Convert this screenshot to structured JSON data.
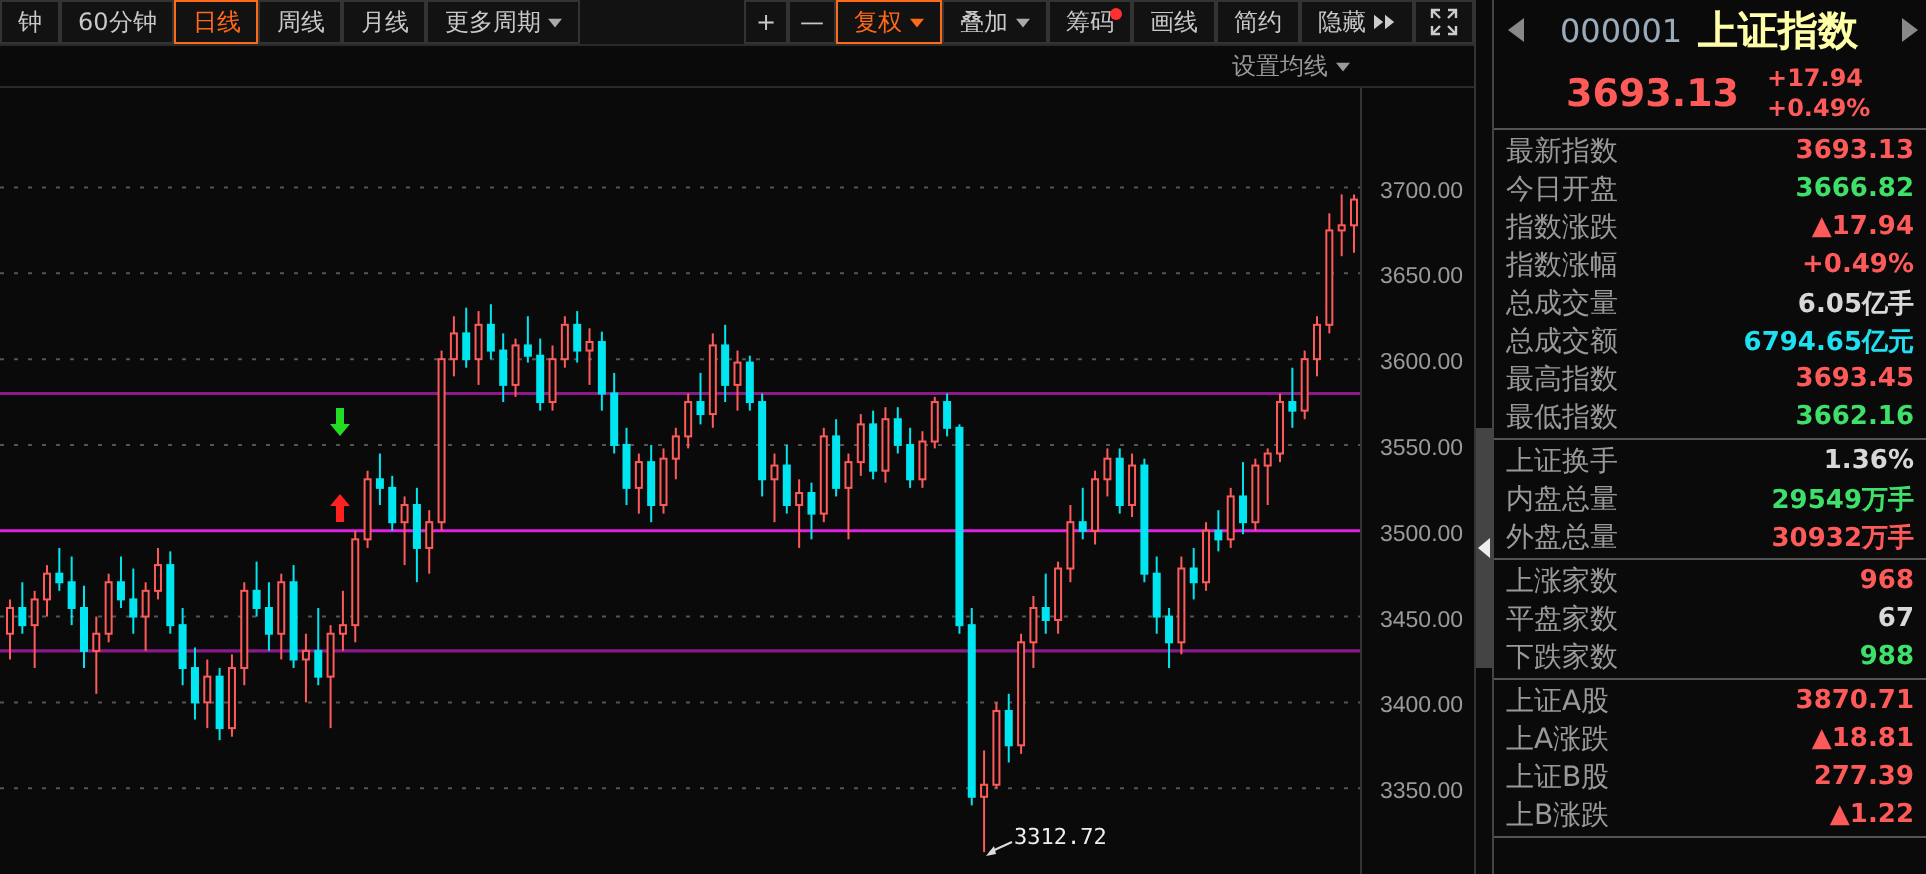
{
  "toolbar": {
    "periods": [
      {
        "label": "钟",
        "selected": false,
        "dropdown": false
      },
      {
        "label": "60分钟",
        "selected": false,
        "dropdown": false
      },
      {
        "label": "日线",
        "selected": true,
        "dropdown": false
      },
      {
        "label": "周线",
        "selected": false,
        "dropdown": false
      },
      {
        "label": "月线",
        "selected": false,
        "dropdown": false
      },
      {
        "label": "更多周期",
        "selected": false,
        "dropdown": true
      }
    ],
    "tools": [
      {
        "kind": "text",
        "label": "+",
        "active": false
      },
      {
        "kind": "text",
        "label": "—",
        "active": false
      },
      {
        "kind": "dropdown",
        "label": "复权",
        "active": true
      },
      {
        "kind": "dropdown",
        "label": "叠加",
        "active": false
      },
      {
        "kind": "dot",
        "label": "筹码",
        "active": false
      },
      {
        "kind": "text",
        "label": "画线",
        "active": false
      },
      {
        "kind": "text",
        "label": "简约",
        "active": false
      },
      {
        "kind": "expand",
        "label": "隐藏",
        "active": false
      },
      {
        "kind": "fullscreen",
        "active": false
      }
    ]
  },
  "ma_settings": {
    "label": "设置均线"
  },
  "chart": {
    "chart_data": {
      "type": "candlestick",
      "ylim": [
        3300,
        3758
      ],
      "grid": true,
      "ref_lines": [
        {
          "axis": "y",
          "value": 3580,
          "color": "#8a1a8a"
        },
        {
          "axis": "y",
          "value": 3500,
          "color": "#e020e0"
        },
        {
          "axis": "y",
          "value": 3430,
          "color": "#8a1a8a"
        }
      ],
      "yticks": [
        {
          "value": 3700,
          "label": "3700.00"
        },
        {
          "value": 3650,
          "label": "3650.00"
        },
        {
          "value": 3600,
          "label": "3600.00"
        },
        {
          "value": 3550,
          "label": "3550.00"
        },
        {
          "value": 3500,
          "label": "3500.00"
        },
        {
          "value": 3450,
          "label": "3450.00"
        },
        {
          "value": 3400,
          "label": "3400.00"
        },
        {
          "value": 3350,
          "label": "3350.00"
        }
      ],
      "ohlc": [
        [
          3440,
          3460,
          3425,
          3455
        ],
        [
          3455,
          3470,
          3440,
          3445
        ],
        [
          3445,
          3465,
          3420,
          3460
        ],
        [
          3460,
          3480,
          3450,
          3475
        ],
        [
          3475,
          3490,
          3465,
          3470
        ],
        [
          3470,
          3485,
          3445,
          3455
        ],
        [
          3455,
          3468,
          3420,
          3430
        ],
        [
          3430,
          3450,
          3405,
          3440
        ],
        [
          3440,
          3475,
          3435,
          3470
        ],
        [
          3470,
          3485,
          3455,
          3460
        ],
        [
          3460,
          3478,
          3440,
          3450
        ],
        [
          3450,
          3470,
          3430,
          3465
        ],
        [
          3465,
          3490,
          3460,
          3480
        ],
        [
          3480,
          3488,
          3440,
          3445
        ],
        [
          3445,
          3455,
          3410,
          3420
        ],
        [
          3420,
          3432,
          3390,
          3400
        ],
        [
          3400,
          3425,
          3385,
          3415
        ],
        [
          3415,
          3420,
          3378,
          3385
        ],
        [
          3385,
          3428,
          3380,
          3420
        ],
        [
          3420,
          3470,
          3410,
          3465
        ],
        [
          3465,
          3482,
          3450,
          3455
        ],
        [
          3455,
          3470,
          3430,
          3440
        ],
        [
          3440,
          3475,
          3425,
          3470
        ],
        [
          3470,
          3480,
          3420,
          3425
        ],
        [
          3425,
          3440,
          3400,
          3430
        ],
        [
          3430,
          3455,
          3410,
          3415
        ],
        [
          3415,
          3445,
          3385,
          3440
        ],
        [
          3440,
          3465,
          3430,
          3445
        ],
        [
          3445,
          3500,
          3435,
          3495
        ],
        [
          3495,
          3535,
          3490,
          3530
        ],
        [
          3530,
          3545,
          3515,
          3525
        ],
        [
          3525,
          3532,
          3500,
          3505
        ],
        [
          3505,
          3520,
          3480,
          3515
        ],
        [
          3515,
          3525,
          3470,
          3490
        ],
        [
          3490,
          3512,
          3475,
          3505
        ],
        [
          3505,
          3605,
          3500,
          3600
        ],
        [
          3600,
          3625,
          3590,
          3615
        ],
        [
          3615,
          3630,
          3595,
          3600
        ],
        [
          3600,
          3628,
          3585,
          3620
        ],
        [
          3620,
          3632,
          3600,
          3605
        ],
        [
          3605,
          3615,
          3575,
          3585
        ],
        [
          3585,
          3612,
          3578,
          3608
        ],
        [
          3608,
          3625,
          3598,
          3602
        ],
        [
          3602,
          3612,
          3570,
          3575
        ],
        [
          3575,
          3608,
          3570,
          3600
        ],
        [
          3600,
          3625,
          3595,
          3620
        ],
        [
          3620,
          3628,
          3598,
          3605
        ],
        [
          3605,
          3618,
          3585,
          3610
        ],
        [
          3610,
          3616,
          3570,
          3580
        ],
        [
          3580,
          3592,
          3545,
          3550
        ],
        [
          3550,
          3560,
          3515,
          3525
        ],
        [
          3525,
          3545,
          3510,
          3540
        ],
        [
          3540,
          3550,
          3505,
          3515
        ],
        [
          3515,
          3548,
          3510,
          3542
        ],
        [
          3542,
          3560,
          3530,
          3555
        ],
        [
          3555,
          3580,
          3548,
          3575
        ],
        [
          3575,
          3592,
          3562,
          3568
        ],
        [
          3568,
          3615,
          3560,
          3608
        ],
        [
          3608,
          3620,
          3575,
          3585
        ],
        [
          3585,
          3605,
          3570,
          3598
        ],
        [
          3598,
          3602,
          3570,
          3575
        ],
        [
          3575,
          3580,
          3520,
          3530
        ],
        [
          3530,
          3545,
          3505,
          3538
        ],
        [
          3538,
          3550,
          3510,
          3515
        ],
        [
          3515,
          3530,
          3490,
          3522
        ],
        [
          3522,
          3528,
          3495,
          3510
        ],
        [
          3510,
          3560,
          3505,
          3555
        ],
        [
          3555,
          3565,
          3520,
          3525
        ],
        [
          3525,
          3545,
          3495,
          3540
        ],
        [
          3540,
          3568,
          3532,
          3562
        ],
        [
          3562,
          3570,
          3530,
          3535
        ],
        [
          3535,
          3572,
          3528,
          3565
        ],
        [
          3565,
          3572,
          3545,
          3550
        ],
        [
          3550,
          3560,
          3525,
          3530
        ],
        [
          3530,
          3558,
          3525,
          3552
        ],
        [
          3552,
          3578,
          3548,
          3575
        ],
        [
          3575,
          3580,
          3555,
          3560
        ],
        [
          3560,
          3562,
          3440,
          3445
        ],
        [
          3445,
          3455,
          3340,
          3345
        ],
        [
          3345,
          3372,
          3312.72,
          3352
        ],
        [
          3352,
          3400,
          3350,
          3395
        ],
        [
          3395,
          3405,
          3365,
          3375
        ],
        [
          3375,
          3440,
          3370,
          3435
        ],
        [
          3435,
          3462,
          3420,
          3455
        ],
        [
          3455,
          3475,
          3440,
          3448
        ],
        [
          3448,
          3482,
          3440,
          3478
        ],
        [
          3478,
          3515,
          3470,
          3505
        ],
        [
          3505,
          3525,
          3495,
          3500
        ],
        [
          3500,
          3535,
          3492,
          3530
        ],
        [
          3530,
          3548,
          3520,
          3542
        ],
        [
          3542,
          3548,
          3510,
          3515
        ],
        [
          3515,
          3545,
          3508,
          3538
        ],
        [
          3538,
          3542,
          3470,
          3475
        ],
        [
          3475,
          3485,
          3440,
          3450
        ],
        [
          3450,
          3455,
          3420,
          3435
        ],
        [
          3435,
          3485,
          3428,
          3478
        ],
        [
          3478,
          3490,
          3460,
          3470
        ],
        [
          3470,
          3505,
          3465,
          3500
        ],
        [
          3500,
          3512,
          3488,
          3495
        ],
        [
          3495,
          3525,
          3490,
          3520
        ],
        [
          3520,
          3540,
          3498,
          3505
        ],
        [
          3505,
          3542,
          3500,
          3538
        ],
        [
          3538,
          3548,
          3515,
          3545
        ],
        [
          3545,
          3580,
          3540,
          3575
        ],
        [
          3575,
          3595,
          3560,
          3570
        ],
        [
          3570,
          3605,
          3565,
          3600
        ],
        [
          3600,
          3625,
          3590,
          3620
        ],
        [
          3620,
          3685,
          3615,
          3675
        ],
        [
          3675,
          3696,
          3660,
          3678
        ],
        [
          3678,
          3696,
          3662,
          3693
        ]
      ]
    },
    "low_label": "3312.72",
    "signals": [
      {
        "kind": "sell"
      },
      {
        "kind": "buy"
      }
    ]
  },
  "quote": {
    "code": "000001",
    "name": "上证指数",
    "price": "3693.13",
    "change": "+17.94",
    "change_pct": "+0.49%"
  },
  "stats": [
    {
      "rows": [
        {
          "label": "最新指数",
          "value": "3693.13",
          "color": "#ff5a5a"
        },
        {
          "label": "今日开盘",
          "value": "3666.82",
          "color": "#3ee06a"
        },
        {
          "label": "指数涨跌",
          "value": "▲17.94",
          "color": "#ff5a5a"
        },
        {
          "label": "指数涨幅",
          "value": "+0.49%",
          "color": "#ff5a5a"
        },
        {
          "label": "总成交量",
          "value": "6.05亿手",
          "color": "#d8d8d8"
        },
        {
          "label": "总成交额",
          "value": "6794.65亿元",
          "color": "#1fe0f0"
        },
        {
          "label": "最高指数",
          "value": "3693.45",
          "color": "#ff5a5a"
        },
        {
          "label": "最低指数",
          "value": "3662.16",
          "color": "#3ee06a"
        }
      ]
    },
    {
      "rows": [
        {
          "label": "上证换手",
          "value": "1.36%",
          "color": "#d8d8d8"
        },
        {
          "label": "内盘总量",
          "value": "29549万手",
          "color": "#3ee06a"
        },
        {
          "label": "外盘总量",
          "value": "30932万手",
          "color": "#ff5a5a"
        }
      ]
    },
    {
      "rows": [
        {
          "label": "上涨家数",
          "value": "968",
          "color": "#ff5a5a"
        },
        {
          "label": "平盘家数",
          "value": "67",
          "color": "#d8d8d8"
        },
        {
          "label": "下跌家数",
          "value": "988",
          "color": "#3ee06a"
        }
      ]
    },
    {
      "rows": [
        {
          "label": "上证A股",
          "value": "3870.71",
          "color": "#ff5a5a"
        },
        {
          "label": "上A涨跌",
          "value": "▲18.81",
          "color": "#ff5a5a"
        },
        {
          "label": "上证B股",
          "value": "277.39",
          "color": "#ff5a5a"
        },
        {
          "label": "上B涨跌",
          "value": "▲1.22",
          "color": "#ff5a5a"
        }
      ]
    }
  ]
}
